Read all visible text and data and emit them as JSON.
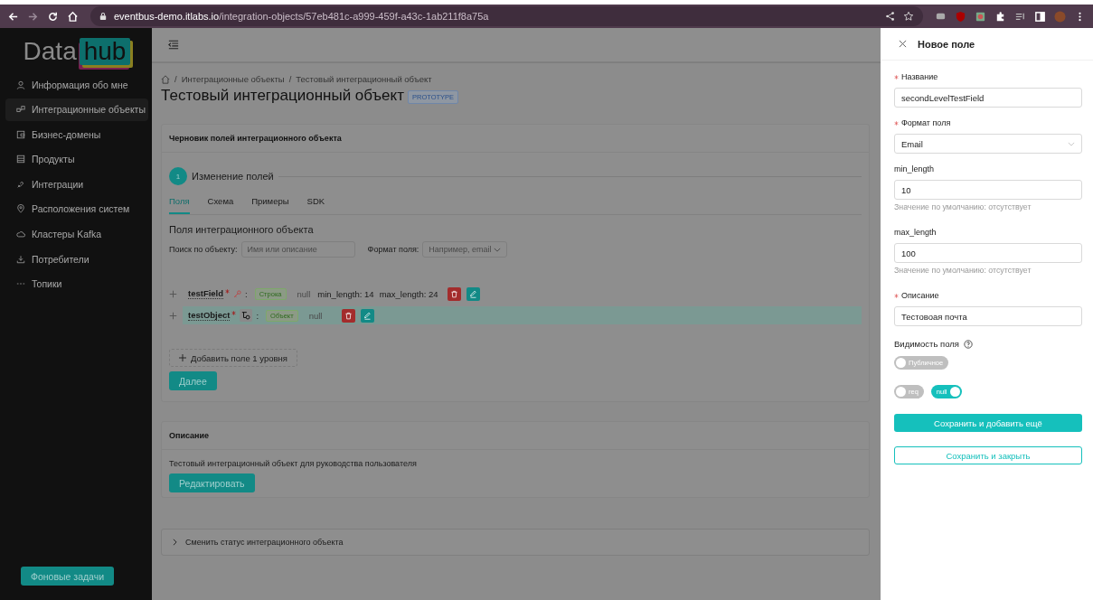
{
  "browser": {
    "url_host": "eventbus-demo.itlabs.io",
    "url_path": "/integration-objects/57eb481c-a999-459f-a43c-1ab211f8a75a"
  },
  "sidebar": {
    "logo_left": "Data",
    "logo_right": "hub",
    "items": [
      {
        "label": "Информация обо мне",
        "selected": false
      },
      {
        "label": "Интеграционные объекты",
        "selected": true
      },
      {
        "label": "Бизнес-домены",
        "selected": false
      },
      {
        "label": "Продукты",
        "selected": false
      },
      {
        "label": "Интеграции",
        "selected": false
      },
      {
        "label": "Расположения систем",
        "selected": false
      },
      {
        "label": "Кластеры Kafka",
        "selected": false
      },
      {
        "label": "Потребители",
        "selected": false
      },
      {
        "label": "Топики",
        "selected": false
      }
    ],
    "bottom_button": "Фоновые задачи"
  },
  "header": {
    "breadcrumb_separator": "/",
    "breadcrumb": [
      "Интеграционные объекты",
      "Тестовый интеграционный объект"
    ],
    "title": "Тестовый интеграционный объект",
    "badge": "PROTOTYPE"
  },
  "draft": {
    "title": "Черновик полей интеграционного объекта",
    "step": {
      "number": "1",
      "label": "Изменение полей"
    },
    "tabs": [
      {
        "label": "Поля",
        "selected": true
      },
      {
        "label": "Схема",
        "selected": false
      },
      {
        "label": "Примеры",
        "selected": false
      },
      {
        "label": "SDK",
        "selected": false
      }
    ],
    "section_title": "Поля интеграционного объекта",
    "filters": [
      {
        "label": "Поиск по объекту:",
        "kind": "input",
        "placeholder": "Имя или описание"
      },
      {
        "label": "Формат поля:",
        "kind": "select",
        "placeholder": "Например, email"
      }
    ],
    "fields": [
      {
        "kind": "key",
        "name": "testField",
        "required": true,
        "colon": ":",
        "type": "Строка",
        "null_text": "null",
        "constraints": [
          "min_length: 14",
          "max_length: 24"
        ],
        "highlighted": false
      },
      {
        "kind": "object",
        "name": "testObject",
        "required": true,
        "colon": ":",
        "type": "Объект",
        "null_text": "null",
        "highlighted": true
      }
    ],
    "add_button": "Добавить поле 1 уровня",
    "next_button": "Далее"
  },
  "description": {
    "title": "Описание",
    "text": "Тестовый интеграционный объект для руководства пользователя",
    "edit_button": "Редактировать"
  },
  "status_panel": {
    "label": "Сменить статус интеграционного объекта",
    "expanded": false
  },
  "drawer": {
    "title": "Новое поле",
    "fields": [
      {
        "kind": "input",
        "label": "Название",
        "required": true,
        "value": "secondLevelTestField"
      },
      {
        "kind": "select",
        "label": "Формат поля",
        "required": true,
        "value": "Email"
      },
      {
        "kind": "input",
        "label": "min_length",
        "required": false,
        "value": "10",
        "hint": "Значение по умолчанию: отсутствует"
      },
      {
        "kind": "input",
        "label": "max_length",
        "required": false,
        "value": "100",
        "hint": "Значение по умолчанию: отсутствует"
      },
      {
        "kind": "input",
        "label": "Описание",
        "required": true,
        "value": "Тестовоая почта"
      }
    ],
    "visibility_label": "Видимость поля",
    "visibility_toggle": {
      "label": "Публичное",
      "on": false
    },
    "toggles": [
      {
        "label": "req",
        "on": false
      },
      {
        "label": "null",
        "on": true
      }
    ],
    "primary_button": "Сохранить и добавить ещё",
    "secondary_button": "Сохранить и закрыть"
  }
}
